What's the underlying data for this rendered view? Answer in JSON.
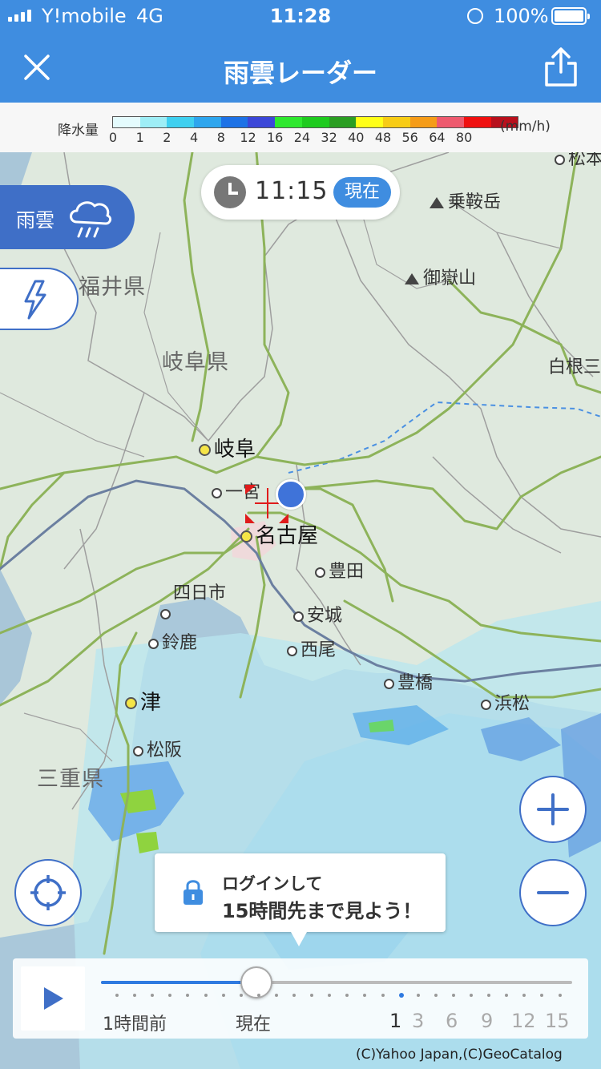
{
  "status_bar": {
    "carrier": "Y!mobile",
    "network": "4G",
    "time": "11:28",
    "battery": "100%"
  },
  "header": {
    "title": "雨雲レーダー",
    "close_icon": "close-icon",
    "share_icon": "share-icon"
  },
  "legend": {
    "label": "降水量",
    "unit": "(mm/h)",
    "ticks": [
      "0",
      "1",
      "2",
      "4",
      "8",
      "12",
      "16",
      "24",
      "32",
      "40",
      "48",
      "56",
      "64",
      "80"
    ],
    "colors": [
      "#e4fbfd",
      "#9eeef6",
      "#3fd0f0",
      "#2ea6ee",
      "#1d72e6",
      "#3b47d8",
      "#2ee82e",
      "#1ecb1e",
      "#2a9e22",
      "#ffff18",
      "#f7cc15",
      "#f59c18",
      "#ee5a6e",
      "#f01010",
      "#b8101c"
    ]
  },
  "time_indicator": {
    "time": "11:15",
    "badge": "現在"
  },
  "layers": {
    "rain_label": "雨雲",
    "rain_icon": "rain-cloud-icon",
    "thunder_icon": "lightning-icon"
  },
  "map": {
    "prefectures": {
      "fukui": "福井県",
      "gifu": "岐阜県",
      "mie": "三重県"
    },
    "mountains": {
      "norikura": "乗鞍岳",
      "ontake": "御嶽山"
    },
    "cities": {
      "gifu": "岐阜",
      "ichinomiya": "一宮",
      "nagoya": "名古屋",
      "toyota": "豊田",
      "yokkaichi": "四日市",
      "anjo": "安城",
      "suzuka": "鈴鹿",
      "nishio": "西尾",
      "toyohashi": "豊橋",
      "hamamatsu": "浜松",
      "tsu": "津",
      "matsusaka": "松阪",
      "shirane": "白根三",
      "matsumoto": "松本"
    }
  },
  "login_prompt": {
    "line1": "ログインして",
    "line2": "15時間先まで見よう！"
  },
  "timeline": {
    "past_label": "1時間前",
    "now_label": "現在",
    "hours": [
      "1",
      "3",
      "6",
      "9",
      "12",
      "15"
    ],
    "progress": 0.33
  },
  "copyright": "(C)Yahoo Japan,(C)GeoCatalog",
  "buttons": {
    "zoom_in": "plus-icon",
    "zoom_out": "minus-icon",
    "locate": "crosshair-icon",
    "play": "play-icon"
  }
}
